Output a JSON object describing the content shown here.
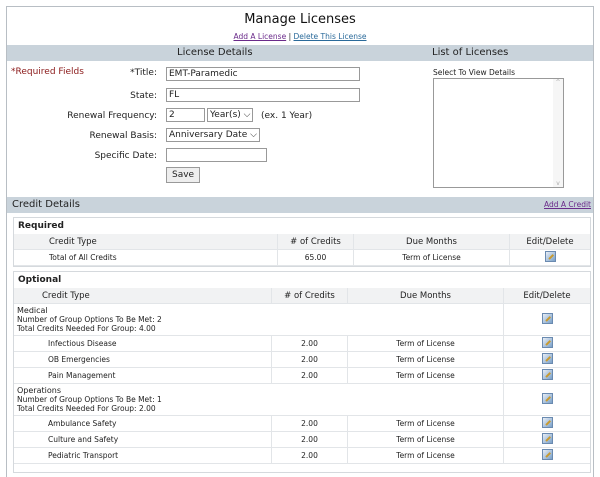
{
  "page_title": "Manage Licenses",
  "links": {
    "add_license": "Add A License",
    "separator": "|",
    "delete_license": "Delete This License"
  },
  "license_details": {
    "header": "License Details",
    "required_fields": "*Required Fields",
    "title_label": "*Title:",
    "title_value": "EMT-Paramedic",
    "state_label": "State:",
    "state_value": "FL",
    "renewal_frequency_label": "Renewal Frequency:",
    "renewal_frequency_value": "2",
    "renewal_unit": "Year(s)",
    "renewal_hint": "(ex. 1 Year)",
    "renewal_basis_label": "Renewal Basis:",
    "renewal_basis_value": "Anniversary Date",
    "specific_date_label": "Specific Date:",
    "specific_date_value": "",
    "save": "Save"
  },
  "list_of_licenses": {
    "header": "List of Licenses",
    "hint": "Select To View Details"
  },
  "credit_details": {
    "header": "Credit Details",
    "add_credit": "Add A Credit",
    "columns": [
      "Credit Type",
      "# of Credits",
      "Due Months",
      "Edit/Delete"
    ],
    "required": {
      "title": "Required",
      "rows": [
        {
          "type": "Total of All Credits",
          "credits": "65.00",
          "due": "Term of License"
        }
      ]
    },
    "optional": {
      "title": "Optional",
      "groups": [
        {
          "name": "Medical",
          "options": "Number of Group Options To Be Met: 2",
          "total": "Total Credits Needed For Group: 4.00",
          "rows": [
            {
              "type": "Infectious Disease",
              "credits": "2.00",
              "due": "Term of License"
            },
            {
              "type": "OB Emergencies",
              "credits": "2.00",
              "due": "Term of License"
            },
            {
              "type": "Pain Management",
              "credits": "2.00",
              "due": "Term of License"
            }
          ]
        },
        {
          "name": "Operations",
          "options": "Number of Group Options To Be Met: 1",
          "total": "Total Credits Needed For Group: 2.00",
          "rows": [
            {
              "type": "Ambulance Safety",
              "credits": "2.00",
              "due": "Term of License"
            },
            {
              "type": "Culture and Safety",
              "credits": "2.00",
              "due": "Term of License"
            },
            {
              "type": "Pediatric Transport",
              "credits": "2.00",
              "due": "Term of License"
            }
          ]
        }
      ]
    }
  }
}
